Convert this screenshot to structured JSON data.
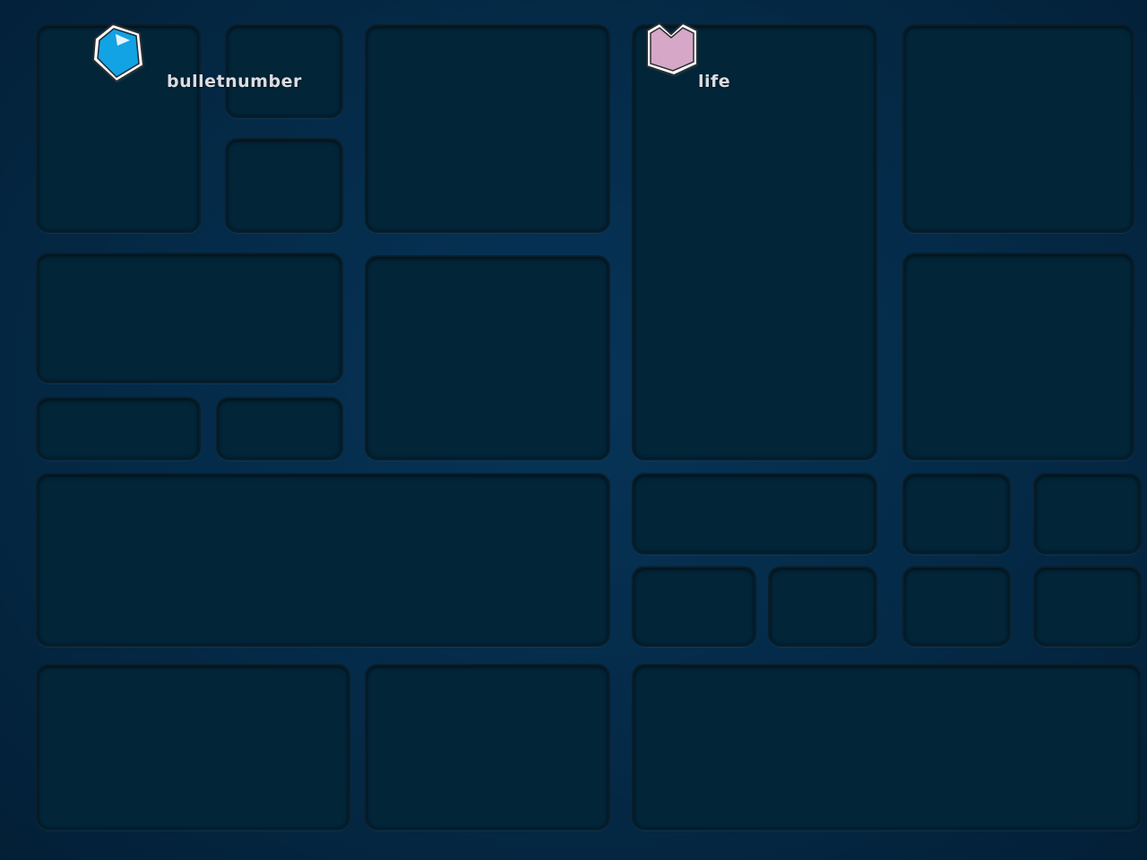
{
  "hud": {
    "bullet": {
      "label": "bulletnumber",
      "icon": "bullet-gem-icon",
      "color": "#12a3e4"
    },
    "life": {
      "label": "life",
      "icon": "heart-gem-icon",
      "color": "#d6a7c7"
    }
  },
  "colors": {
    "background": "#042a47",
    "tile": "#032538",
    "tile_border": "#0a1e2a",
    "label": "#d9dde3"
  }
}
